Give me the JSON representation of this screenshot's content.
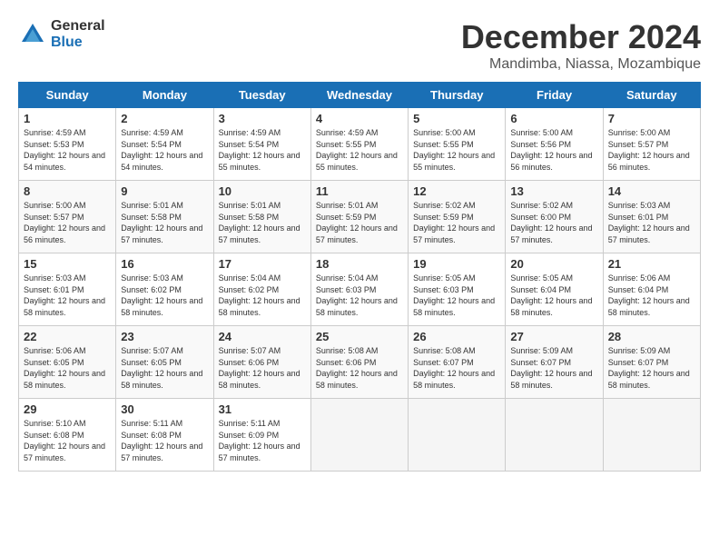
{
  "logo": {
    "general": "General",
    "blue": "Blue"
  },
  "title": "December 2024",
  "location": "Mandimba, Niassa, Mozambique",
  "days_header": [
    "Sunday",
    "Monday",
    "Tuesday",
    "Wednesday",
    "Thursday",
    "Friday",
    "Saturday"
  ],
  "weeks": [
    [
      {
        "day": "1",
        "sunrise": "Sunrise: 4:59 AM",
        "sunset": "Sunset: 5:53 PM",
        "daylight": "Daylight: 12 hours and 54 minutes."
      },
      {
        "day": "2",
        "sunrise": "Sunrise: 4:59 AM",
        "sunset": "Sunset: 5:54 PM",
        "daylight": "Daylight: 12 hours and 54 minutes."
      },
      {
        "day": "3",
        "sunrise": "Sunrise: 4:59 AM",
        "sunset": "Sunset: 5:54 PM",
        "daylight": "Daylight: 12 hours and 55 minutes."
      },
      {
        "day": "4",
        "sunrise": "Sunrise: 4:59 AM",
        "sunset": "Sunset: 5:55 PM",
        "daylight": "Daylight: 12 hours and 55 minutes."
      },
      {
        "day": "5",
        "sunrise": "Sunrise: 5:00 AM",
        "sunset": "Sunset: 5:55 PM",
        "daylight": "Daylight: 12 hours and 55 minutes."
      },
      {
        "day": "6",
        "sunrise": "Sunrise: 5:00 AM",
        "sunset": "Sunset: 5:56 PM",
        "daylight": "Daylight: 12 hours and 56 minutes."
      },
      {
        "day": "7",
        "sunrise": "Sunrise: 5:00 AM",
        "sunset": "Sunset: 5:57 PM",
        "daylight": "Daylight: 12 hours and 56 minutes."
      }
    ],
    [
      {
        "day": "8",
        "sunrise": "Sunrise: 5:00 AM",
        "sunset": "Sunset: 5:57 PM",
        "daylight": "Daylight: 12 hours and 56 minutes."
      },
      {
        "day": "9",
        "sunrise": "Sunrise: 5:01 AM",
        "sunset": "Sunset: 5:58 PM",
        "daylight": "Daylight: 12 hours and 57 minutes."
      },
      {
        "day": "10",
        "sunrise": "Sunrise: 5:01 AM",
        "sunset": "Sunset: 5:58 PM",
        "daylight": "Daylight: 12 hours and 57 minutes."
      },
      {
        "day": "11",
        "sunrise": "Sunrise: 5:01 AM",
        "sunset": "Sunset: 5:59 PM",
        "daylight": "Daylight: 12 hours and 57 minutes."
      },
      {
        "day": "12",
        "sunrise": "Sunrise: 5:02 AM",
        "sunset": "Sunset: 5:59 PM",
        "daylight": "Daylight: 12 hours and 57 minutes."
      },
      {
        "day": "13",
        "sunrise": "Sunrise: 5:02 AM",
        "sunset": "Sunset: 6:00 PM",
        "daylight": "Daylight: 12 hours and 57 minutes."
      },
      {
        "day": "14",
        "sunrise": "Sunrise: 5:03 AM",
        "sunset": "Sunset: 6:01 PM",
        "daylight": "Daylight: 12 hours and 57 minutes."
      }
    ],
    [
      {
        "day": "15",
        "sunrise": "Sunrise: 5:03 AM",
        "sunset": "Sunset: 6:01 PM",
        "daylight": "Daylight: 12 hours and 58 minutes."
      },
      {
        "day": "16",
        "sunrise": "Sunrise: 5:03 AM",
        "sunset": "Sunset: 6:02 PM",
        "daylight": "Daylight: 12 hours and 58 minutes."
      },
      {
        "day": "17",
        "sunrise": "Sunrise: 5:04 AM",
        "sunset": "Sunset: 6:02 PM",
        "daylight": "Daylight: 12 hours and 58 minutes."
      },
      {
        "day": "18",
        "sunrise": "Sunrise: 5:04 AM",
        "sunset": "Sunset: 6:03 PM",
        "daylight": "Daylight: 12 hours and 58 minutes."
      },
      {
        "day": "19",
        "sunrise": "Sunrise: 5:05 AM",
        "sunset": "Sunset: 6:03 PM",
        "daylight": "Daylight: 12 hours and 58 minutes."
      },
      {
        "day": "20",
        "sunrise": "Sunrise: 5:05 AM",
        "sunset": "Sunset: 6:04 PM",
        "daylight": "Daylight: 12 hours and 58 minutes."
      },
      {
        "day": "21",
        "sunrise": "Sunrise: 5:06 AM",
        "sunset": "Sunset: 6:04 PM",
        "daylight": "Daylight: 12 hours and 58 minutes."
      }
    ],
    [
      {
        "day": "22",
        "sunrise": "Sunrise: 5:06 AM",
        "sunset": "Sunset: 6:05 PM",
        "daylight": "Daylight: 12 hours and 58 minutes."
      },
      {
        "day": "23",
        "sunrise": "Sunrise: 5:07 AM",
        "sunset": "Sunset: 6:05 PM",
        "daylight": "Daylight: 12 hours and 58 minutes."
      },
      {
        "day": "24",
        "sunrise": "Sunrise: 5:07 AM",
        "sunset": "Sunset: 6:06 PM",
        "daylight": "Daylight: 12 hours and 58 minutes."
      },
      {
        "day": "25",
        "sunrise": "Sunrise: 5:08 AM",
        "sunset": "Sunset: 6:06 PM",
        "daylight": "Daylight: 12 hours and 58 minutes."
      },
      {
        "day": "26",
        "sunrise": "Sunrise: 5:08 AM",
        "sunset": "Sunset: 6:07 PM",
        "daylight": "Daylight: 12 hours and 58 minutes."
      },
      {
        "day": "27",
        "sunrise": "Sunrise: 5:09 AM",
        "sunset": "Sunset: 6:07 PM",
        "daylight": "Daylight: 12 hours and 58 minutes."
      },
      {
        "day": "28",
        "sunrise": "Sunrise: 5:09 AM",
        "sunset": "Sunset: 6:07 PM",
        "daylight": "Daylight: 12 hours and 58 minutes."
      }
    ],
    [
      {
        "day": "29",
        "sunrise": "Sunrise: 5:10 AM",
        "sunset": "Sunset: 6:08 PM",
        "daylight": "Daylight: 12 hours and 57 minutes."
      },
      {
        "day": "30",
        "sunrise": "Sunrise: 5:11 AM",
        "sunset": "Sunset: 6:08 PM",
        "daylight": "Daylight: 12 hours and 57 minutes."
      },
      {
        "day": "31",
        "sunrise": "Sunrise: 5:11 AM",
        "sunset": "Sunset: 6:09 PM",
        "daylight": "Daylight: 12 hours and 57 minutes."
      },
      null,
      null,
      null,
      null
    ]
  ]
}
